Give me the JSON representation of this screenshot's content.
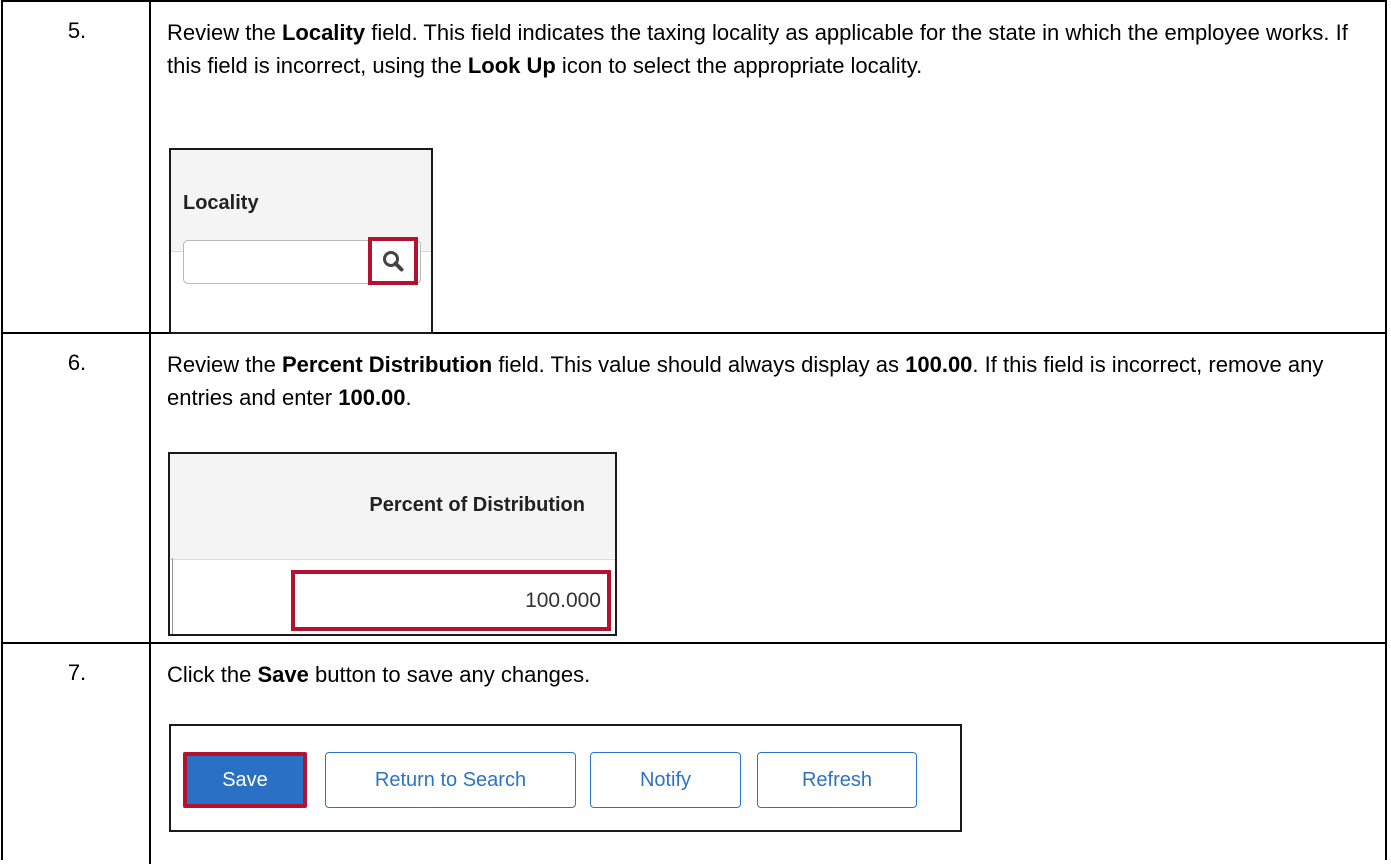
{
  "steps": [
    {
      "number": "5.",
      "text": [
        {
          "t": "Review the ",
          "b": false
        },
        {
          "t": "Locality",
          "b": true
        },
        {
          "t": " field.  This field indicates the taxing locality as applicable for the state in which the employee works.  If this field is incorrect, using the ",
          "b": false
        },
        {
          "t": "Look Up",
          "b": true
        },
        {
          "t": " icon to select the appropriate locality.",
          "b": false
        }
      ],
      "figure": {
        "header": "Locality",
        "input_value": ""
      }
    },
    {
      "number": "6.",
      "text": [
        {
          "t": "Review the ",
          "b": false
        },
        {
          "t": "Percent Distribution",
          "b": true
        },
        {
          "t": " field.  This value should always display as ",
          "b": false
        },
        {
          "t": "100.00",
          "b": true
        },
        {
          "t": ". If this field is incorrect, remove any entries and enter ",
          "b": false
        },
        {
          "t": "100.00",
          "b": true
        },
        {
          "t": ".",
          "b": false
        }
      ],
      "figure": {
        "header": "Percent of Distribution",
        "input_value": "100.000"
      }
    },
    {
      "number": "7.",
      "text": [
        {
          "t": "Click the ",
          "b": false
        },
        {
          "t": "Save",
          "b": true
        },
        {
          "t": " button to save any changes.",
          "b": false
        }
      ],
      "figure": {
        "buttons": {
          "save": "Save",
          "return_to_search": "Return to Search",
          "notify": "Notify",
          "refresh": "Refresh"
        }
      }
    }
  ],
  "colors": {
    "highlight": "#b5122f",
    "primary_button": "#2a70c4",
    "secondary_button_text": "#2c73c7"
  },
  "icons": {
    "lookup": "search-icon"
  }
}
